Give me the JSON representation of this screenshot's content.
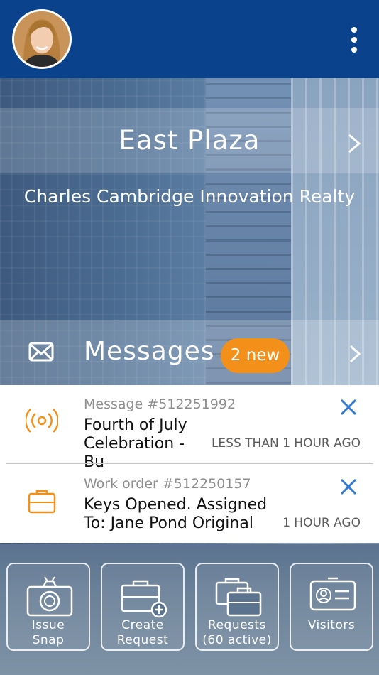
{
  "header": {
    "avatar_alt": "User avatar",
    "menu_icon": "more-vertical-icon"
  },
  "building": {
    "name": "East Plaza",
    "organization": "Charles Cambridge Innovation Realty"
  },
  "messages": {
    "label": "Messages",
    "badge": "2 new",
    "items": [
      {
        "icon": "broadcast-icon",
        "subtitle": "Message #512251992",
        "title": "Fourth of July\nCelebration - Bu",
        "time": "LESS THAN 1 HOUR AGO"
      },
      {
        "icon": "briefcase-icon",
        "subtitle": "Work order #512250157",
        "title": "Keys Opened. Assigned\nTo: Jane Pond Original",
        "time": "1 HOUR AGO"
      }
    ]
  },
  "tiles": [
    {
      "icon": "camera-bug-icon",
      "label": "Issue\nSnap"
    },
    {
      "icon": "briefcase-add-icon",
      "label": "Create\nRequest"
    },
    {
      "icon": "briefcases-icon",
      "label": "Requests\n(60 active)"
    },
    {
      "icon": "id-card-icon",
      "label": "Visitors"
    }
  ],
  "colors": {
    "topbar": "#0b428c",
    "accent": "#f39019",
    "close": "#2f7bd6"
  }
}
